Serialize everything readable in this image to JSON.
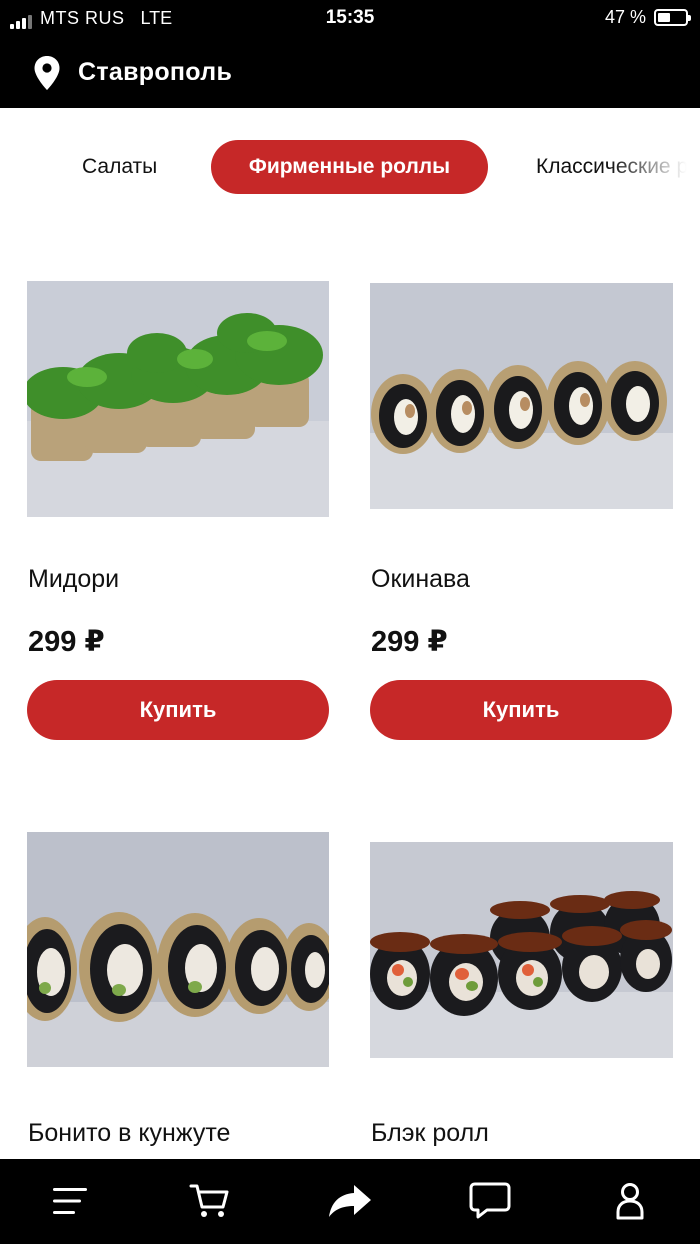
{
  "status_bar": {
    "carrier": "MTS RUS",
    "network": "LTE",
    "time": "15:35",
    "battery": "47 %",
    "battery_level": 0.47
  },
  "header": {
    "city": "Ставрополь",
    "icon": "location-pin-icon"
  },
  "tabs": [
    {
      "label": "Салаты",
      "active": false
    },
    {
      "label": "Фирменные роллы",
      "active": true
    },
    {
      "label": "Классические роллы",
      "active": false
    }
  ],
  "products": [
    {
      "name": "Мидори",
      "price": "299 ₽",
      "button": "Купить",
      "image": "roll with seaweed salad topping"
    },
    {
      "name": "Окинава",
      "price": "299 ₽",
      "button": "Купить",
      "image": "black rice rolls with sesame"
    },
    {
      "name": "Бонито в кунжуте",
      "price": "",
      "button": "",
      "image": "black rice rolls in sesame"
    },
    {
      "name": "Блэк ролл",
      "price": "",
      "button": "",
      "image": "black rice rolls with eel and sauce"
    }
  ],
  "bottom_nav": [
    {
      "name": "menu",
      "icon": "menu-icon"
    },
    {
      "name": "cart",
      "icon": "cart-icon"
    },
    {
      "name": "share",
      "icon": "share-icon"
    },
    {
      "name": "chat",
      "icon": "chat-icon"
    },
    {
      "name": "profile",
      "icon": "profile-icon"
    }
  ],
  "colors": {
    "accent": "#c62828",
    "bar_background": "#000000",
    "background": "#ffffff"
  }
}
